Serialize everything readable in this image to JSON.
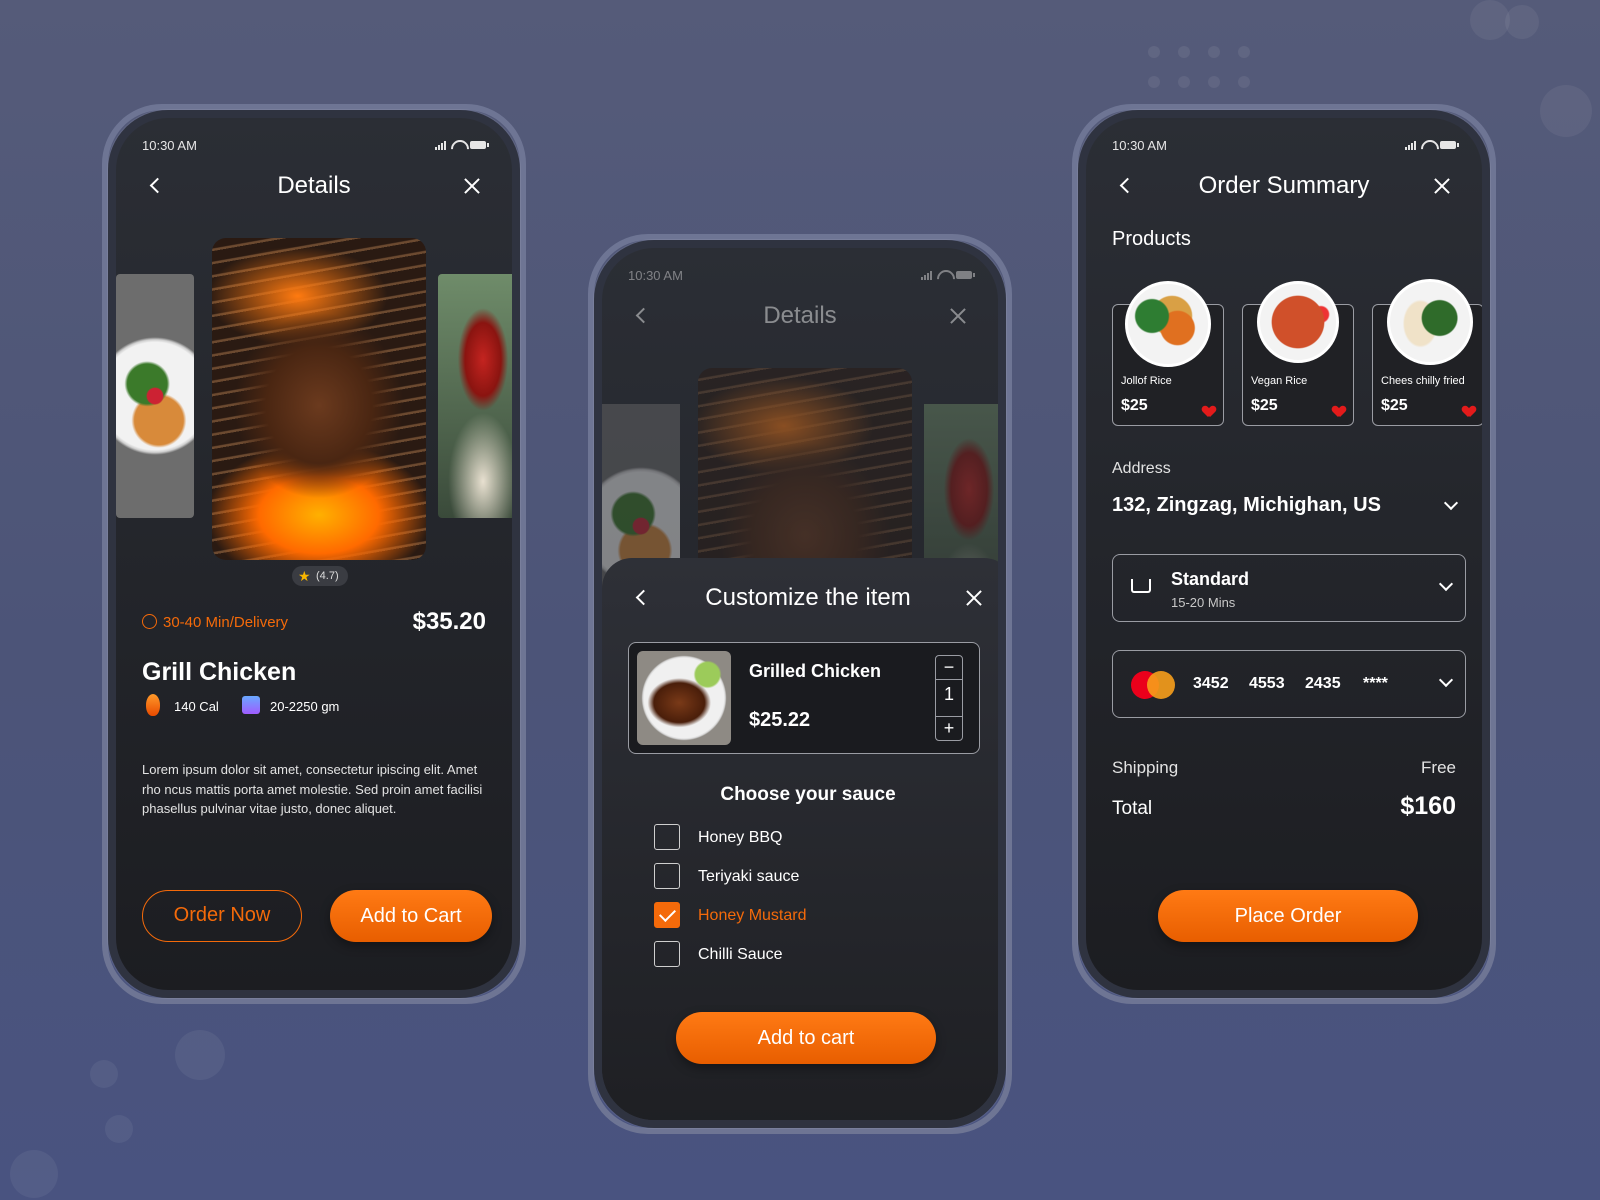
{
  "status_time": "10:30 AM",
  "screen1": {
    "title": "Details",
    "rating": "(4.7)",
    "delivery": "30-40 Min/Delivery",
    "price": "$35.20",
    "name": "Grill Chicken",
    "calories": "140 Cal",
    "weight": "20-2250 gm",
    "description": "Lorem ipsum dolor sit amet, consectetur ipiscing  elit. Amet rho ncus mattis  porta amet molestie. Sed proin amet facilisi phasellus pulvinar vitae justo, donec aliquet.",
    "order_now": "Order Now",
    "add_to_cart": "Add to Cart"
  },
  "screen2": {
    "title": "Details",
    "sheet_title": "Customize the item",
    "item_name": "Grilled Chicken",
    "item_price": "$25.22",
    "quantity": "1",
    "sauce_heading": "Choose your sauce",
    "sauces": [
      {
        "label": "Honey BBQ",
        "checked": false
      },
      {
        "label": "Teriyaki sauce",
        "checked": false
      },
      {
        "label": "Honey Mustard",
        "checked": true
      },
      {
        "label": "Chilli Sauce",
        "checked": false
      }
    ],
    "add_to_cart": "Add to cart"
  },
  "screen3": {
    "title": "Order Summary",
    "products_label": "Products",
    "products": [
      {
        "name": "Jollof Rice",
        "price": "$25"
      },
      {
        "name": "Vegan Rice",
        "price": "$25"
      },
      {
        "name": "Chees chilly fried",
        "price": "$25"
      }
    ],
    "address_label": "Address",
    "address": "132, Zingzag, Michighan, US",
    "shipping_option": "Standard",
    "shipping_time": "15-20 Mins",
    "card_groups": [
      "3452",
      "4553",
      "2435",
      "****"
    ],
    "shipping_label": "Shipping",
    "shipping_value": "Free",
    "total_label": "Total",
    "total_value": "$160",
    "place_order": "Place Order"
  },
  "colors": {
    "accent": "#f46a0a",
    "background": "#4f5679",
    "screen": "#232529",
    "heart": "#e31b1b"
  }
}
